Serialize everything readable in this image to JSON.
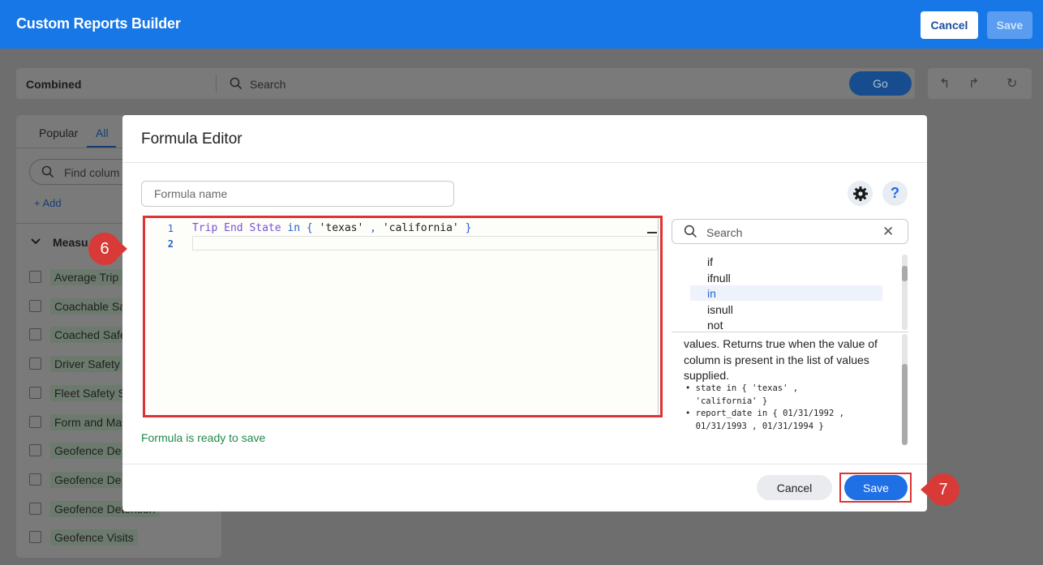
{
  "header": {
    "title": "Custom Reports Builder",
    "cancel_label": "Cancel",
    "save_label": "Save"
  },
  "toolbar": {
    "source": "Combined",
    "search_placeholder": "Search",
    "go_label": "Go",
    "undo_icon": "undo-icon",
    "redo_icon": "redo-icon",
    "reset_icon": "reset-icon"
  },
  "left_panel": {
    "tabs": [
      "Popular",
      "All"
    ],
    "active_tab": "All",
    "find_placeholder": "Find colum",
    "add_label": "+ Add",
    "section_label": "Measu",
    "items": [
      "Average Trip S",
      "Coachable Sa",
      "Coached Safe",
      "Driver Safety S",
      "Fleet Safety S",
      "Form and Ma",
      "Geofence De",
      "Geofence De",
      "Geofence Detention",
      "Geofence Visits"
    ]
  },
  "formula_editor": {
    "title": "Formula Editor",
    "name_placeholder": "Formula name",
    "line_numbers": [
      "1",
      "2"
    ],
    "code_line1": {
      "part1": "Trip End State",
      "part2": "in",
      "part3": "{",
      "part4": "'texas'",
      "part5": ",",
      "part6": "'california'",
      "part7": "}"
    },
    "status": "Formula is ready to save",
    "settings_icon": "gear-icon",
    "help_label": "?",
    "search_placeholder": "Search",
    "functions": [
      "if",
      "ifnull",
      "in",
      "isnull",
      "not"
    ],
    "selected_function": "in",
    "description": "values. Returns true when the value of column is present in the list of values supplied.",
    "examples": [
      "• state in { 'texas' ,\n  'california' }",
      "• report_date in { 01/31/1992 ,\n  01/31/1993 , 01/31/1994 }"
    ],
    "cancel_label": "Cancel",
    "save_label": "Save"
  },
  "markers": {
    "step6": "6",
    "step7": "7"
  },
  "colors": {
    "brand_blue": "#1877e6",
    "annotation_red": "#d83a38",
    "success_green": "#1f8a4a"
  }
}
